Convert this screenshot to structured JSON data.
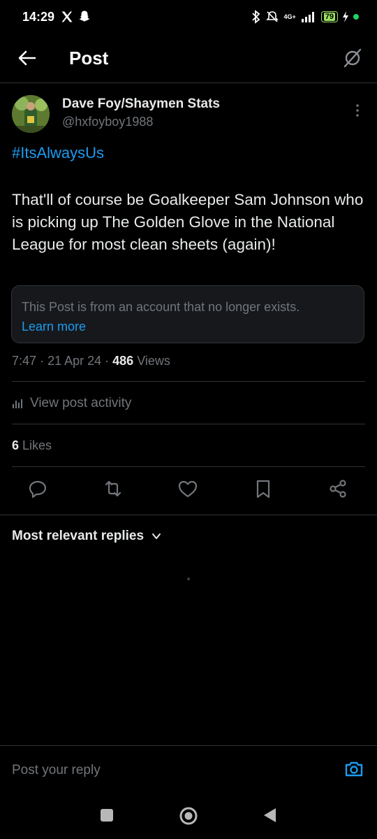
{
  "status_bar": {
    "time": "14:29",
    "network": "4G+",
    "battery": "79"
  },
  "header": {
    "title": "Post"
  },
  "post": {
    "author_name": "Dave Foy/Shaymen Stats",
    "author_handle": "@hxfoyboy1988",
    "hashtag": "#ItsAlwaysUs",
    "body": "That'll of course be Goalkeeper Sam Johnson who is picking up The Golden Glove in the National League for most clean sheets (again)!",
    "notice_text": "This Post is from an account that no longer exists.",
    "notice_link": "Learn more",
    "time": "7:47",
    "date": "21 Apr 24",
    "views_count": "486",
    "views_label": "Views",
    "activity_label": "View post activity",
    "likes_count": "6",
    "likes_label": "Likes"
  },
  "replies": {
    "sort_label": "Most relevant replies"
  },
  "reply_bar": {
    "placeholder": "Post your reply"
  },
  "colors": {
    "accent": "#1d9bf0",
    "background": "#000000",
    "muted": "#71767b"
  }
}
